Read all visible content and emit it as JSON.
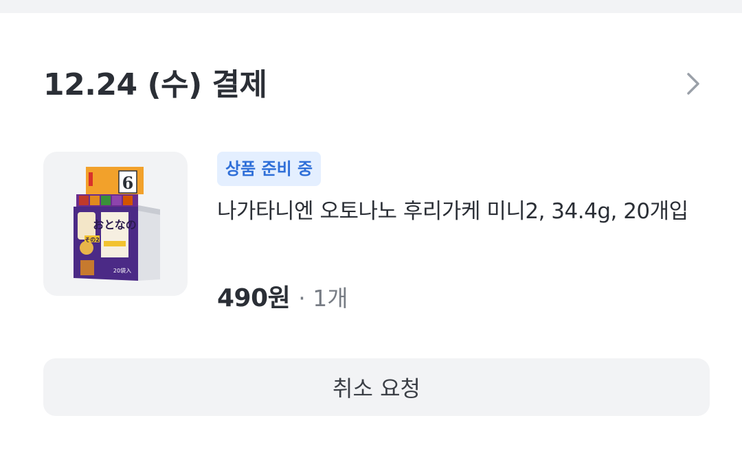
{
  "order": {
    "date_title": "12.24 (수) 결제",
    "chevron_icon": "chevron-right-icon"
  },
  "product": {
    "status_badge": "상품 준비 중",
    "name": "나가타니엔 오토나노 후리가케 미니2, 34.4g, 20개입",
    "price": "490원",
    "quantity": "· 1개",
    "image_icon": "product-thumbnail",
    "package_text": {
      "count_badge": "6",
      "series": "その2",
      "title": "おとなの",
      "pieces": "20袋入"
    }
  },
  "actions": {
    "cancel_label": "취소 요청"
  },
  "colors": {
    "badge_bg": "#e4efff",
    "badge_text": "#2f6fd8",
    "text_primary": "#2b2f36",
    "text_secondary": "#777c84",
    "surface": "#f2f3f5"
  }
}
